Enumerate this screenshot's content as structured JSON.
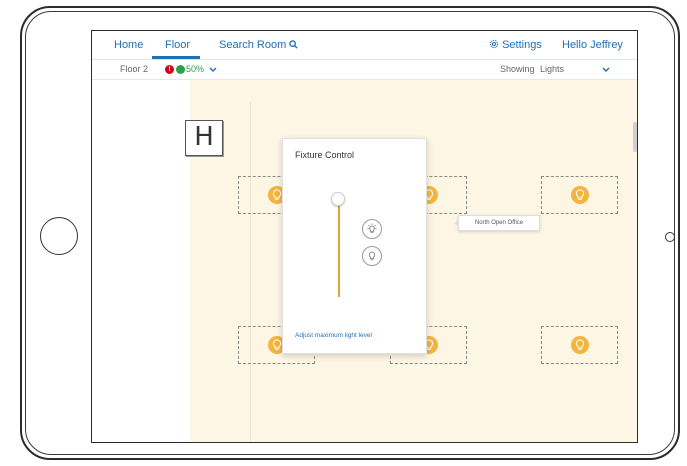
{
  "nav": {
    "home": "Home",
    "floor": "Floor",
    "search_room": "Search Room",
    "settings": "Settings",
    "greeting": "Hello Jeffrey"
  },
  "subbar": {
    "floor_name": "Floor 2",
    "alert_count": "!",
    "status_percent": "50%",
    "showing_label": "Showing",
    "showing_value": "Lights"
  },
  "map": {
    "sign_letter": "H",
    "tooltip": "North Open Office"
  },
  "popup": {
    "title": "Fixture Control",
    "link": "Adjust maximum light level",
    "slider_level": 1.0
  },
  "colors": {
    "accent": "#1d6fb8",
    "bulb": "#f3b53f",
    "alert": "#d0021b",
    "ok": "#2aa14a",
    "floor_background": "#fdf6e4"
  },
  "icons": [
    "search-icon",
    "gear-icon",
    "chevron-down-icon",
    "lightbulb-icon",
    "lightbulb-bright-icon"
  ]
}
